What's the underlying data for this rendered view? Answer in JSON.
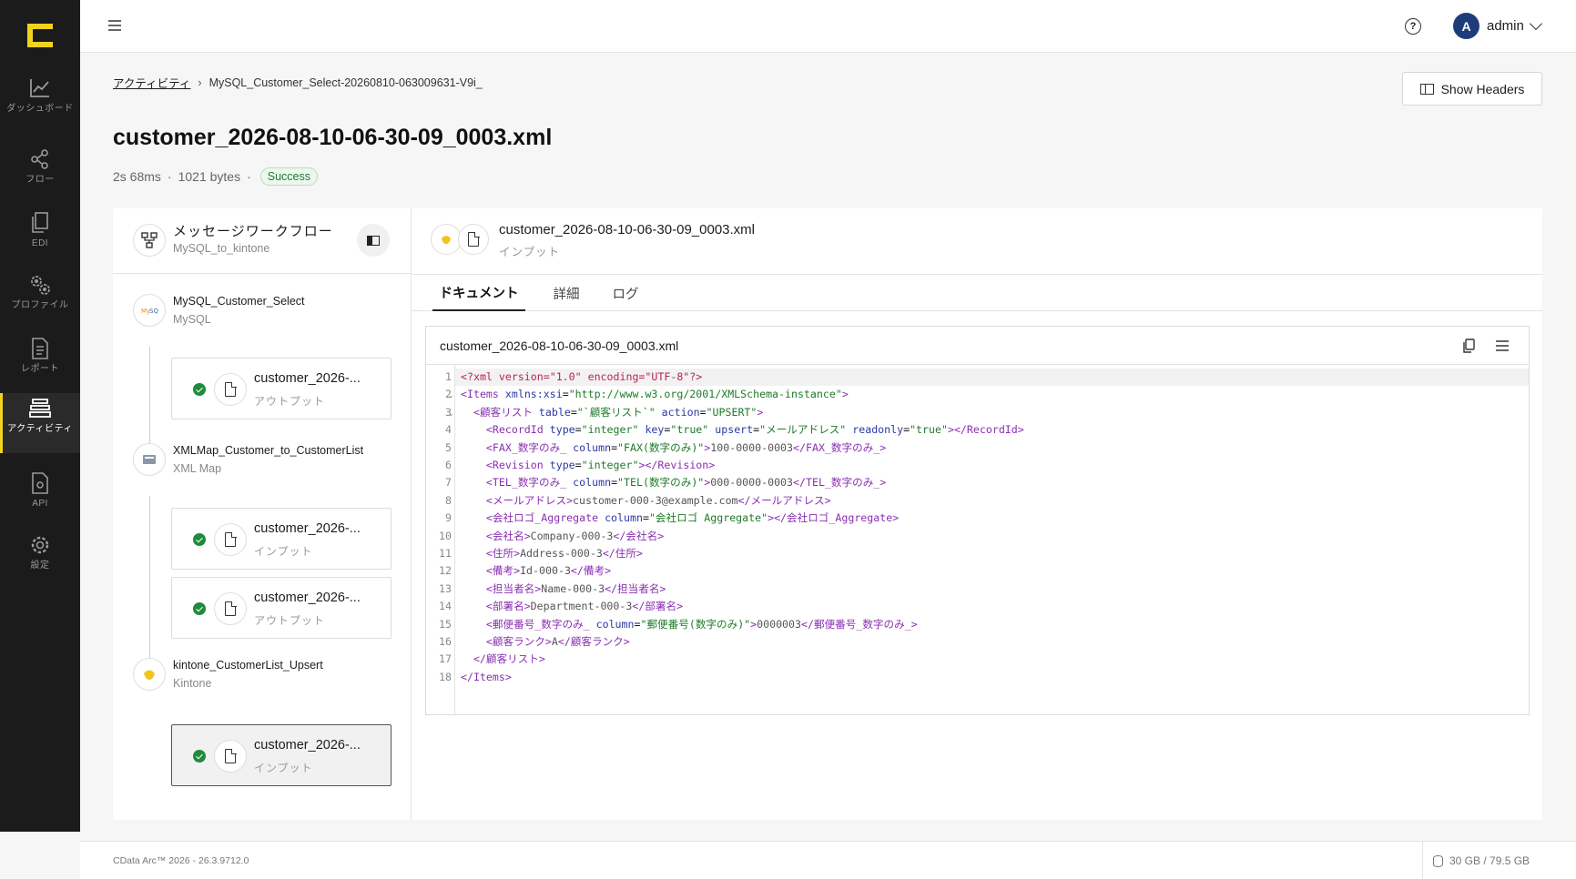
{
  "nav": {
    "items": [
      {
        "label": "ダッシュボード",
        "icon": "chart-line-icon"
      },
      {
        "label": "フロー",
        "icon": "share-nodes-icon"
      },
      {
        "label": "EDI",
        "icon": "documents-icon"
      },
      {
        "label": "プロファイル",
        "icon": "gears-icon"
      },
      {
        "label": "レポート",
        "icon": "report-icon"
      },
      {
        "label": "アクティビティ",
        "icon": "layers-icon"
      },
      {
        "label": "API",
        "icon": "api-doc-icon"
      },
      {
        "label": "設定",
        "icon": "gear-icon"
      }
    ]
  },
  "topbar": {
    "user_initial": "A",
    "username": "admin"
  },
  "breadcrumb": {
    "parent": "アクティビティ",
    "separator": "›",
    "current": "MySQL_Customer_Select-20260810-063009631-V9i_"
  },
  "page": {
    "title": "customer_2026-08-10-06-30-09_0003.xml",
    "duration": "2s 68ms",
    "size": "1021 bytes",
    "dot": "·",
    "status": "Success",
    "show_headers_label": "Show Headers"
  },
  "workflow": {
    "title": "メッセージワークフロー",
    "subtitle": "MySQL_to_kintone",
    "connectors": [
      {
        "name": "MySQL_Customer_Select",
        "type": "MySQL"
      },
      {
        "name": "XMLMap_Customer_to_CustomerList",
        "type": "XML Map"
      },
      {
        "name": "kintone_CustomerList_Upsert",
        "type": "Kintone"
      }
    ],
    "files": [
      {
        "name": "customer_2026-...",
        "type": "アウトプット"
      },
      {
        "name": "customer_2026-...",
        "type": "インプット"
      },
      {
        "name": "customer_2026-...",
        "type": "アウトプット"
      },
      {
        "name": "customer_2026-...",
        "type": "インプット"
      }
    ]
  },
  "detail": {
    "title": "customer_2026-08-10-06-30-09_0003.xml",
    "subtitle": "インプット",
    "tabs": [
      "ドキュメント",
      "詳細",
      "ログ"
    ],
    "editor_filename": "customer_2026-08-10-06-30-09_0003.xml",
    "lines": [
      "<?xml version=\"1.0\" encoding=\"UTF-8\"?>",
      "<Items xmlns:xsi=\"http://www.w3.org/2001/XMLSchema-instance\">",
      "  <顧客リスト table=\"`顧客リスト`\" action=\"UPSERT\">",
      "    <RecordId type=\"integer\" key=\"true\" upsert=\"メールアドレス\" readonly=\"true\"></RecordId>",
      "    <FAX_数字のみ_ column=\"FAX(数字のみ)\">100-0000-0003</FAX_数字のみ_>",
      "    <Revision type=\"integer\"></Revision>",
      "    <TEL_数字のみ_ column=\"TEL(数字のみ)\">000-0000-0003</TEL_数字のみ_>",
      "    <メールアドレス>customer-000-3@example.com</メールアドレス>",
      "    <会社ロゴ_Aggregate column=\"会社ロゴ Aggregate\"></会社ロゴ_Aggregate>",
      "    <会社名>Company-000-3</会社名>",
      "    <住所>Address-000-3</住所>",
      "    <備考>Id-000-3</備考>",
      "    <担当者名>Name-000-3</担当者名>",
      "    <部署名>Department-000-3</部署名>",
      "    <郵便番号_数字のみ_ column=\"郵便番号(数字のみ)\">0000003</郵便番号_数字のみ_>",
      "    <顧客ランク>A</顧客ランク>",
      "  </顧客リスト>",
      "</Items>"
    ]
  },
  "footer": {
    "version": "CData Arc™ 2026 - 26.3.9712.0",
    "disk": "30 GB / 79.5 GB"
  },
  "colors": {
    "sidebar_bg": "#1b1b1b",
    "brand_yellow": "#f2d31b",
    "success_green": "#1f8b3b",
    "avatar_blue": "#1f3c7a"
  }
}
